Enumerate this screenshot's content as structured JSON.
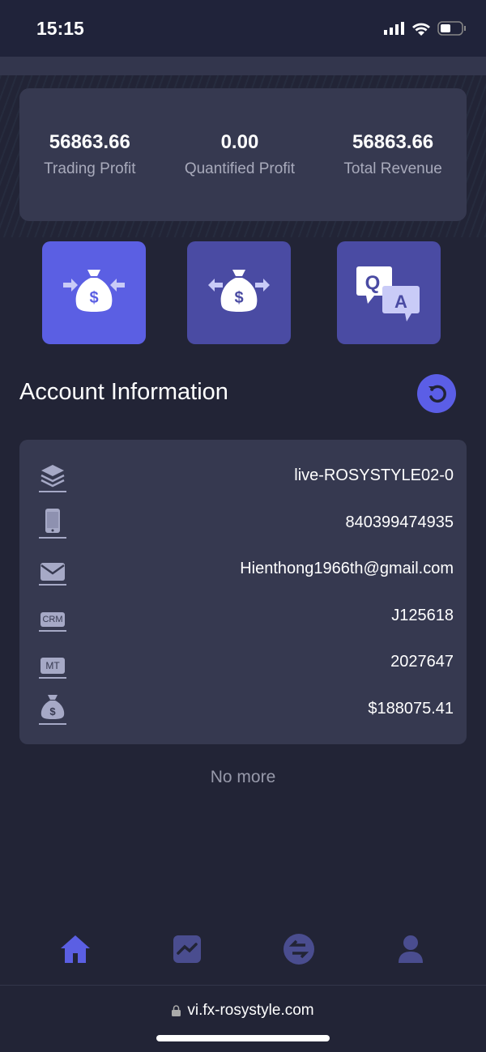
{
  "status_bar": {
    "time": "15:15"
  },
  "summary": [
    {
      "value": "56863.66",
      "label": "Trading Profit"
    },
    {
      "value": "0.00",
      "label": "Quantified Profit"
    },
    {
      "value": "56863.66",
      "label": "Total Revenue"
    }
  ],
  "actions": [
    {
      "icon": "deposit-icon",
      "color": "#5b5fe3"
    },
    {
      "icon": "withdraw-icon",
      "color": "#4a4ba3"
    },
    {
      "icon": "qa-icon",
      "color": "#4a4ba3"
    }
  ],
  "account": {
    "title": "Account Information",
    "rows": [
      {
        "icon": "layers-icon",
        "value": "live-ROSYSTYLE02-0"
      },
      {
        "icon": "phone-icon",
        "value": "840399474935"
      },
      {
        "icon": "mail-icon",
        "value": "Hienthong1966th@gmail.com"
      },
      {
        "icon": "crm-icon",
        "label": "CRM",
        "value": "J125618"
      },
      {
        "icon": "mt-icon",
        "label": "MT",
        "value": "2027647"
      },
      {
        "icon": "money-bag-icon",
        "value": "$188075.41"
      }
    ],
    "footer": "No more"
  },
  "tabs": [
    "home",
    "chart",
    "exchange",
    "profile"
  ],
  "browser": {
    "url": "vi.fx-rosystyle.com"
  },
  "colors": {
    "accent": "#5b5fe3",
    "card": "#363950",
    "background": "#222436"
  }
}
